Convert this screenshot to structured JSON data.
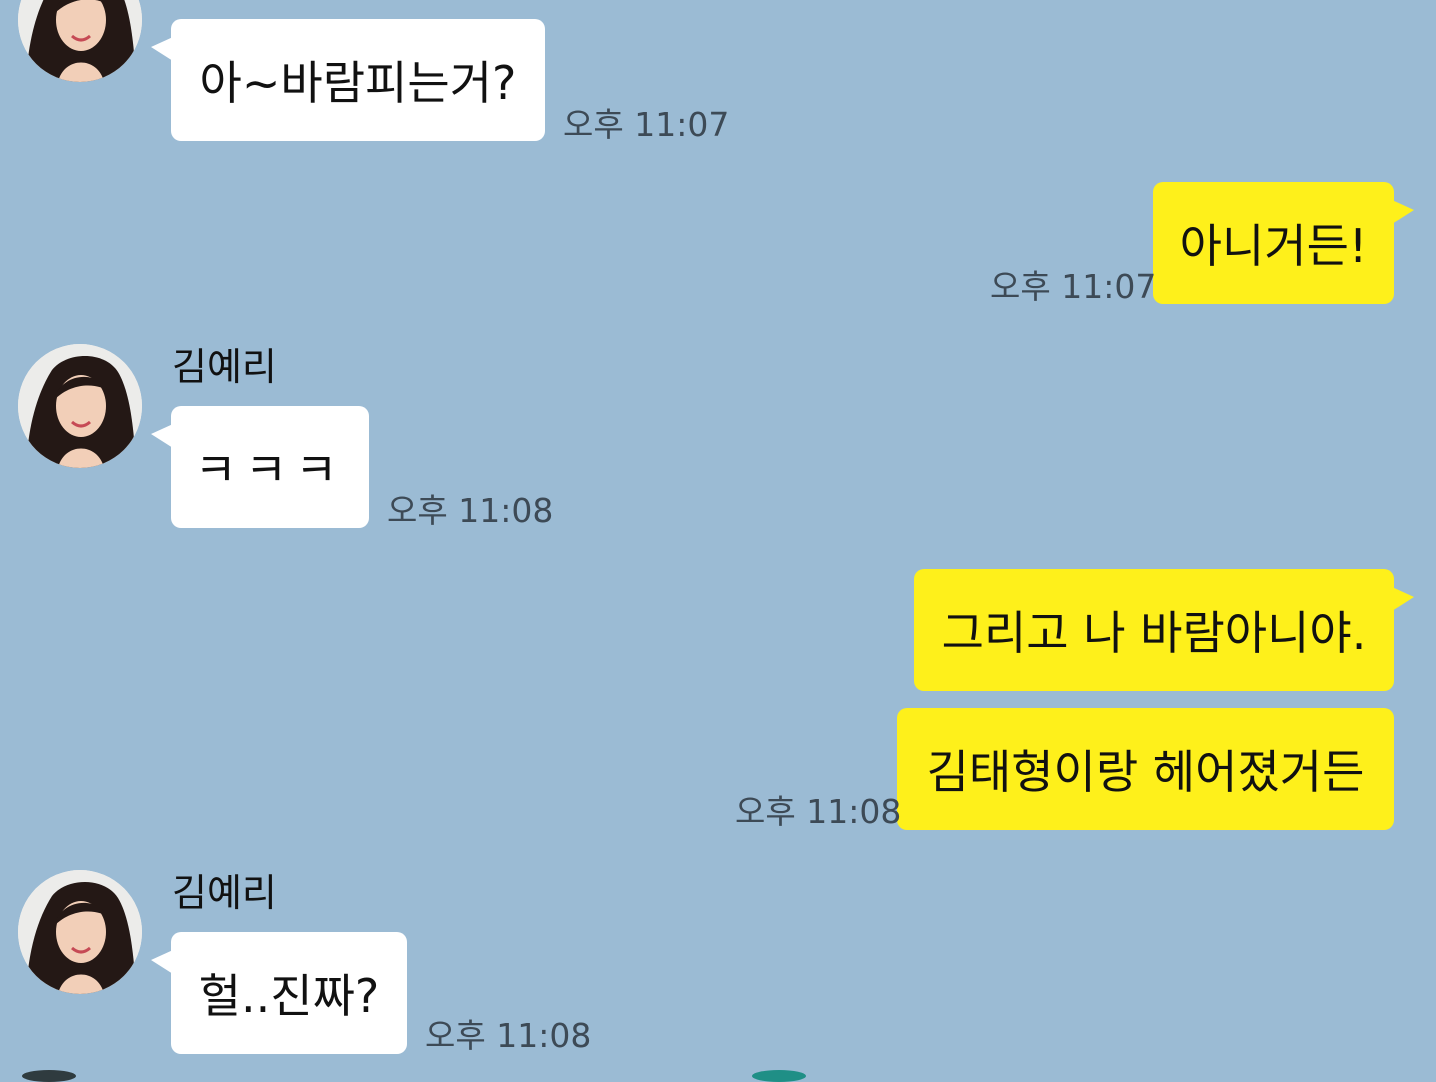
{
  "theme": {
    "chat_bg": "#9bbbd4",
    "incoming_bubble": "#ffffff",
    "outgoing_bubble": "#fef01b"
  },
  "messages": [
    {
      "direction": "incoming",
      "text": "아~바람피는거?",
      "time": "오후 11:07"
    },
    {
      "direction": "outgoing",
      "text": "아니거든!",
      "time": "오후 11:07"
    },
    {
      "direction": "incoming",
      "sender": "김예리",
      "text": "ㅋㅋㅋ",
      "time": "오후 11:08"
    },
    {
      "direction": "outgoing",
      "text": "그리고 나 바람아니야."
    },
    {
      "direction": "outgoing",
      "text": "김태형이랑 헤어졌거든",
      "time": "오후 11:08"
    },
    {
      "direction": "incoming",
      "sender": "김예리",
      "text": "헐..진짜?",
      "time": "오후 11:08"
    }
  ]
}
